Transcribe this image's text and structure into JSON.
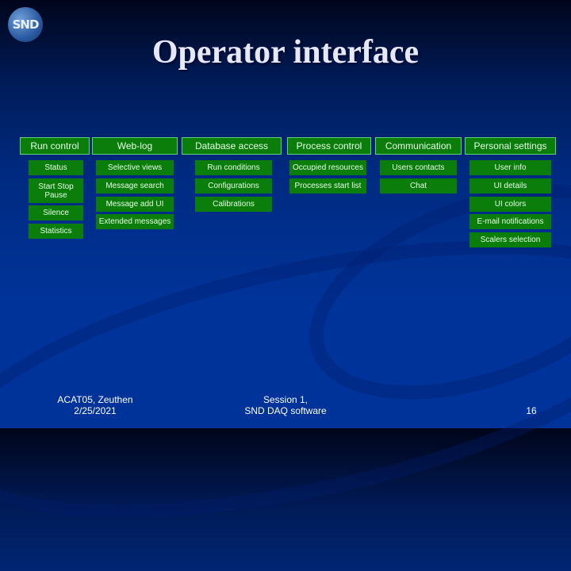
{
  "slide": {
    "logo_text": "SND",
    "title": "Operator interface"
  },
  "columns": [
    {
      "header": "Run control",
      "items": [
        "Status",
        "Start Stop Pause",
        "Silence",
        "Statistics"
      ]
    },
    {
      "header": "Web-log",
      "items": [
        "Selective views",
        "Message search",
        "Message add UI",
        "Extended messages"
      ]
    },
    {
      "header": "Database access",
      "items": [
        "Run conditions",
        "Configurations",
        "Calibrations"
      ]
    },
    {
      "header": "Process control",
      "items": [
        "Occupied resources",
        "Processes start list"
      ]
    },
    {
      "header": "Communication",
      "items": [
        "Users contacts",
        "Chat"
      ]
    },
    {
      "header": "Personal settings",
      "items": [
        "User info",
        "UI details",
        "UI colors",
        "E-mail notifications",
        "Scalers selection"
      ]
    }
  ],
  "footer": {
    "left_line1": "ACAT05,  Zeuthen",
    "left_line2": "2/25/2021",
    "center_line1": "Session 1,",
    "center_line2": "SND DAQ software",
    "page_number": "16"
  }
}
